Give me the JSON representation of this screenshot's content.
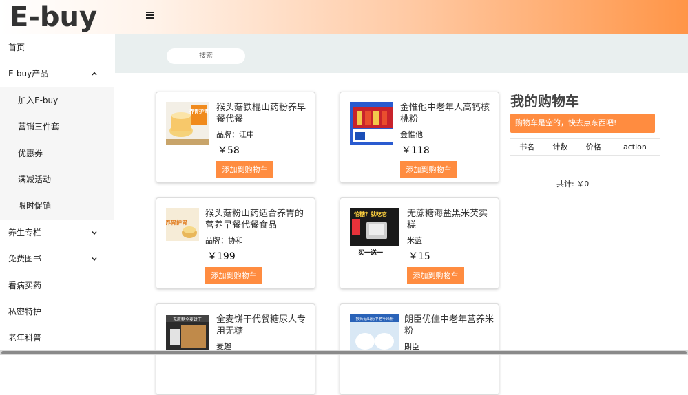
{
  "header": {
    "logo": "E-buy",
    "menu_icon": "hamburger-icon"
  },
  "sidebar": {
    "items": [
      {
        "label": "首页"
      },
      {
        "label": "E-buy产品",
        "chevron": "up"
      },
      {
        "label": "加入E-buy",
        "sub": true
      },
      {
        "label": "营销三件套",
        "sub": true
      },
      {
        "label": "优惠券",
        "sub": true
      },
      {
        "label": "满减活动",
        "sub": true
      },
      {
        "label": "限时促销",
        "sub": true
      },
      {
        "label": "养生专栏",
        "chevron": "down"
      },
      {
        "label": "免费图书",
        "chevron": "down"
      },
      {
        "label": "看病买药"
      },
      {
        "label": "私密特护"
      },
      {
        "label": "老年科普"
      }
    ]
  },
  "search": {
    "placeholder": "搜索"
  },
  "products": [
    {
      "name": "猴头菇铁棍山药粉养早餐代餐",
      "brand": "品牌：江中",
      "price": "￥58",
      "button": "添加到购物车",
      "thumb_text": "养胃护胃"
    },
    {
      "name": "金惟他中老年人高钙核桃粉",
      "brand": "金惟他",
      "price": "￥118",
      "button": "添加到购物车",
      "thumb_text": ""
    },
    {
      "name": "猴头菇粉山药适合养胃的营养早餐代餐食品",
      "brand": "品牌：协和",
      "price": "￥199",
      "button": "添加到购物车",
      "thumb_text": "养胃护胃"
    },
    {
      "name": "无蔗糖海盐黑米芡实糕",
      "brand": "米蓝",
      "price": "￥15",
      "button": "添加到购物车",
      "thumb_text": "怕糖？就吃它",
      "thumb_text2": "买一送一"
    },
    {
      "name": "全麦饼干代餐糖尿人专用无糖",
      "brand": "麦趣",
      "price": "",
      "button": "",
      "thumb_text": "无蔗糖全麦饼干"
    },
    {
      "name": "朗臣优佳中老年营养米粉",
      "brand": "朗臣",
      "price": "",
      "button": "",
      "thumb_text": "猴头菇山药中老年米粉"
    }
  ],
  "cart": {
    "title": "我的购物车",
    "empty_message": "购物车是空的，快去点东西吧!",
    "columns": [
      "书名",
      "计数",
      "价格",
      "action"
    ],
    "total": "共计: ￥0"
  },
  "colors": {
    "accent": "#ff8c40",
    "search_band": "#e9efef"
  }
}
